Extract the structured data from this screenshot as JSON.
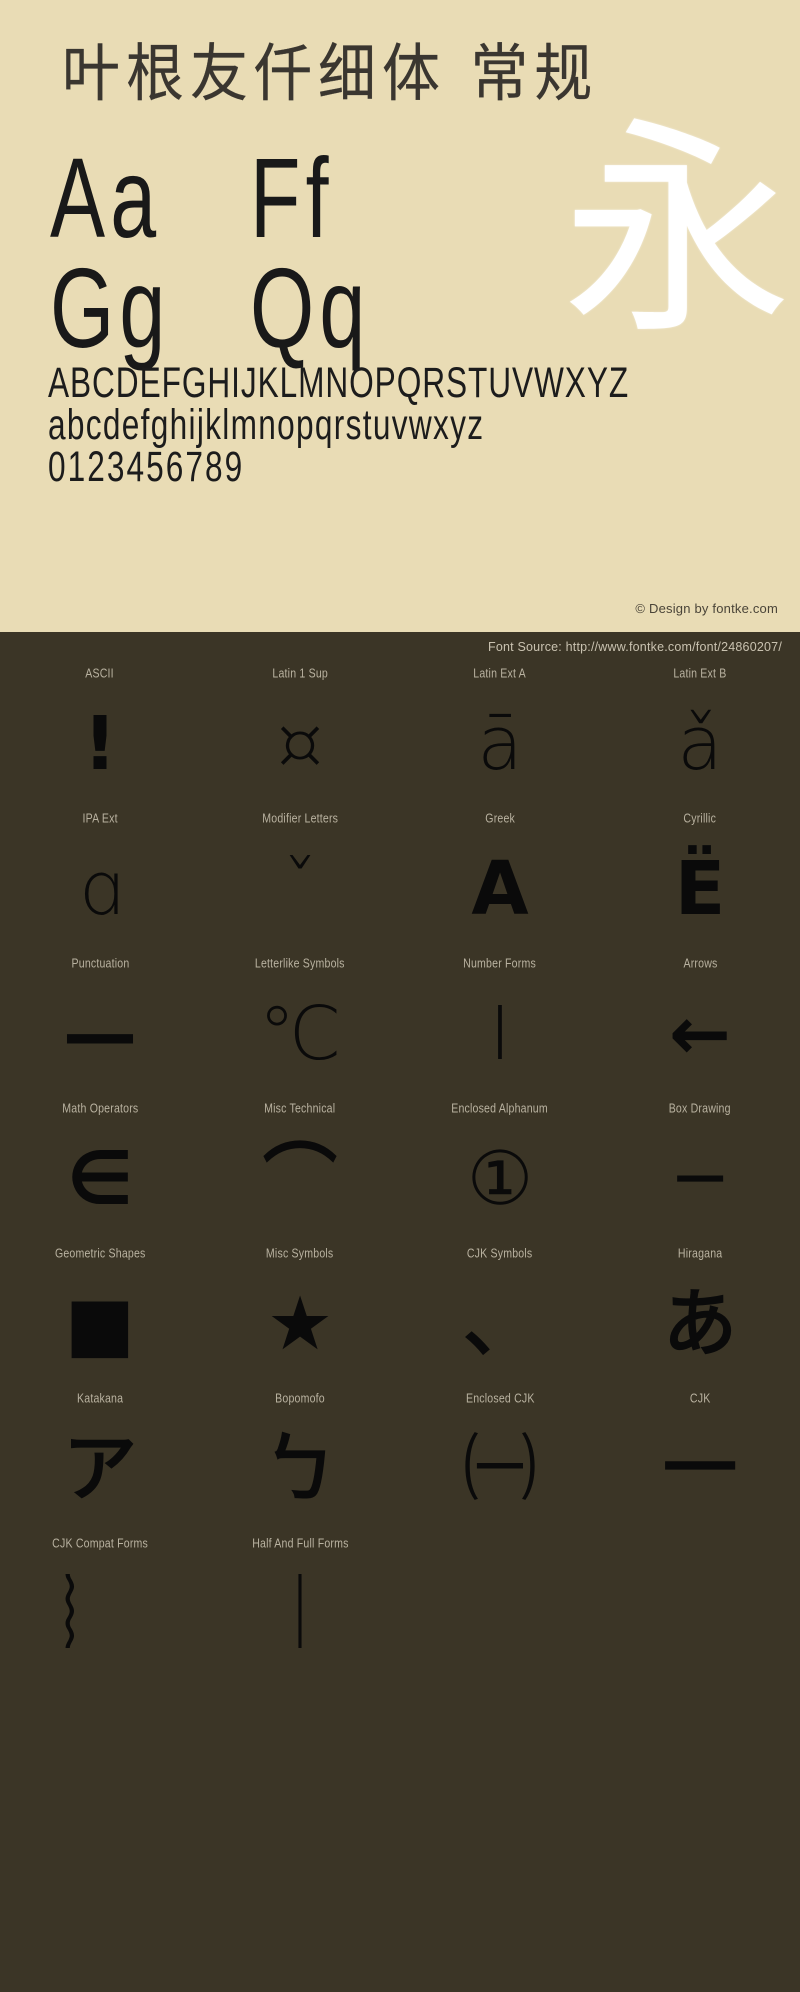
{
  "specimen": {
    "title": "叶根友仟细体 常规",
    "hero_glyph": "永",
    "pairs": [
      {
        "left": "Aa",
        "right": "Ff"
      },
      {
        "left": "Gg",
        "right": "Qq"
      }
    ],
    "uppercase": "ABCDEFGHIJKLMNOPQRSTUVWXYZ",
    "lowercase": "abcdefghijklmnopqrstuvwxyz",
    "digits": "0123456789",
    "design_credit": "© Design by fontke.com"
  },
  "source": {
    "text": "Font Source: http://www.fontke.com/font/24860207/"
  },
  "colors": {
    "specimen_bg": "#e9dcb5",
    "dark_bg": "#3b3526",
    "glyph_ink": "#0a0a0a",
    "hero_white": "#ffffff",
    "label_text": "#b9b2a0"
  },
  "unicode_blocks": [
    {
      "label": "ASCII",
      "glyph": "!",
      "style": "heavy"
    },
    {
      "label": "Latin 1 Sup",
      "glyph": "¤",
      "style": "thin"
    },
    {
      "label": "Latin Ext A",
      "glyph": "ā",
      "style": "thin"
    },
    {
      "label": "Latin Ext B",
      "glyph": "ǎ",
      "style": "thin"
    },
    {
      "label": "IPA Ext",
      "glyph": "ɑ",
      "style": "thin"
    },
    {
      "label": "Modifier Letters",
      "glyph": "ˇ",
      "style": "thin"
    },
    {
      "label": "Greek",
      "glyph": "Α",
      "style": "heavy"
    },
    {
      "label": "Cyrillic",
      "glyph": "Ё",
      "style": "heavy"
    },
    {
      "label": "Punctuation",
      "glyph": "—",
      "style": "heavy"
    },
    {
      "label": "Letterlike Symbols",
      "glyph": "℃",
      "style": "thin"
    },
    {
      "label": "Number Forms",
      "glyph": "Ⅰ",
      "style": "thin"
    },
    {
      "label": "Arrows",
      "glyph": "←",
      "style": "heavy"
    },
    {
      "label": "Math Operators",
      "glyph": "∈",
      "style": "heavy"
    },
    {
      "label": "Misc Technical",
      "glyph": "⌒",
      "style": "heavy"
    },
    {
      "label": "Enclosed Alphanum",
      "glyph": "①",
      "style": "thin"
    },
    {
      "label": "Box Drawing",
      "glyph": "─",
      "style": "heavy"
    },
    {
      "label": "Geometric Shapes",
      "glyph": "■",
      "style": "heavy"
    },
    {
      "label": "Misc Symbols",
      "glyph": "★",
      "style": "heavy"
    },
    {
      "label": "CJK Symbols",
      "glyph": "、",
      "style": "heavy"
    },
    {
      "label": "Hiragana",
      "glyph": "あ",
      "style": "heavy"
    },
    {
      "label": "Katakana",
      "glyph": "ア",
      "style": "heavy"
    },
    {
      "label": "Bopomofo",
      "glyph": "ㄅ",
      "style": "heavy"
    },
    {
      "label": "Enclosed CJK",
      "glyph": "㈠",
      "style": "thin"
    },
    {
      "label": "CJK",
      "glyph": "一",
      "style": "heavy"
    },
    {
      "label": "CJK Compat Forms",
      "glyph": "︴",
      "style": "thin"
    },
    {
      "label": "Half And Full Forms",
      "glyph": "｜",
      "style": "thin"
    }
  ]
}
